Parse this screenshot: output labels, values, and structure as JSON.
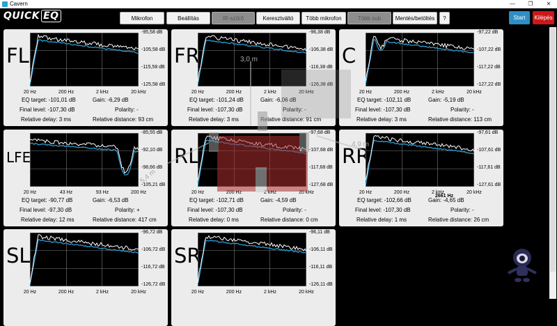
{
  "window": {
    "title": "Cavern",
    "minimize": "—",
    "maximize": "❐",
    "close": "✕"
  },
  "toolbar": {
    "logo_text": "QUICK",
    "logo_eq": "EQ",
    "buttons": [
      {
        "label": "Mikrofon",
        "state": "normal"
      },
      {
        "label": "Beállítás",
        "state": "normal"
      },
      {
        "label": "IR-szűrő",
        "state": "selected"
      },
      {
        "label": "Keresztváltó",
        "state": "normal"
      },
      {
        "label": "Több mikrofon",
        "state": "normal"
      },
      {
        "label": "Több sub",
        "state": "disabled"
      },
      {
        "label": "Mentés/betöltés",
        "state": "normal"
      },
      {
        "label": "?",
        "state": "normal"
      }
    ],
    "start_label": "Start",
    "exit_label": "Kilépés",
    "start_color": "#2d8fc5",
    "exit_color": "#cd1818"
  },
  "colors": {
    "measured": "#ffffff",
    "corrected": "#2aa0d8",
    "grid": "#7f7f7f"
  },
  "overlay": {
    "height_label": "3,0 m",
    "side_label": "4,9 m",
    "front_label": "5,4 m",
    "freq_tooltip": "2661 Hz"
  },
  "channels": [
    {
      "name": "FL",
      "y_labels": [
        "-95,58 dB",
        "-105,58 dB",
        "-115,58 dB",
        "-125,58 dB"
      ],
      "x_labels": [
        "20 Hz",
        "200 Hz",
        "2 kHz",
        "20 kHz"
      ],
      "eq_target": "EQ target: -101,01 dB",
      "gain": "Gain: -6,29 dB",
      "final_level": "Final level: -107,30 dB",
      "polarity": "Polarity: -",
      "relative_delay": "Relative delay: 3 ms",
      "relative_distance": "Relative distance: 93 cm"
    },
    {
      "name": "FR",
      "y_labels": [
        "-96,38 dB",
        "-106,38 dB",
        "-116,38 dB",
        "-126,38 dB"
      ],
      "x_labels": [
        "20 Hz",
        "200 Hz",
        "2 kHz",
        "20 kHz"
      ],
      "eq_target": "EQ target: -101,24 dB",
      "gain": "Gain: -6,06 dB",
      "final_level": "Final level: -107,30 dB",
      "polarity": "Polarity: -",
      "relative_delay": "Relative delay: 3 ms",
      "relative_distance": "Relative distance: 91 cm"
    },
    {
      "name": "C",
      "y_labels": [
        "-97,22 dB",
        "-107,22 dB",
        "-117,22 dB",
        "-127,22 dB"
      ],
      "x_labels": [
        "20 Hz",
        "200 Hz",
        "2 kHz",
        "20 kHz"
      ],
      "eq_target": "EQ target: -102,11 dB",
      "gain": "Gain: -5,19 dB",
      "final_level": "Final level: -107,30 dB",
      "polarity": "Polarity: -",
      "relative_delay": "Relative delay: 3 ms",
      "relative_distance": "Relative distance: 113 cm"
    },
    {
      "name": "LFE",
      "y_labels": [
        "-85,55 dB",
        "-92,10 dB",
        "-98,66 dB",
        "-105,21 dB"
      ],
      "x_labels": [
        "20 Hz",
        "43 Hz",
        "93 Hz",
        "200 Hz"
      ],
      "eq_target": "EQ target: -90,77 dB",
      "gain": "Gain: -6,53 dB",
      "final_level": "Final level: -97,30 dB",
      "polarity": "Polarity: +",
      "relative_delay": "Relative delay: 12 ms",
      "relative_distance": "Relative distance: 417 cm"
    },
    {
      "name": "RL",
      "y_labels": [
        "-97,68 dB",
        "-107,68 dB",
        "-117,68 dB",
        "-127,68 dB"
      ],
      "x_labels": [
        "20 Hz",
        "200 Hz",
        "2 kHz",
        "20 kHz"
      ],
      "eq_target": "EQ target: -102,71 dB",
      "gain": "Gain: -4,59 dB",
      "final_level": "Final level: -107,30 dB",
      "polarity": "Polarity: -",
      "relative_delay": "Relative delay: 0 ms",
      "relative_distance": "Relative distance: 0 cm"
    },
    {
      "name": "RR",
      "y_labels": [
        "-97,61 dB",
        "-107,61 dB",
        "-117,61 dB",
        "-127,61 dB"
      ],
      "x_labels": [
        "20 Hz",
        "200 Hz",
        "2 kHz",
        "20 kHz"
      ],
      "eq_target": "EQ target: -102,66 dB",
      "gain": "Gain: -4,65 dB",
      "final_level": "Final level: -107,30 dB",
      "polarity": "Polarity: -",
      "relative_delay": "Relative delay: 1 ms",
      "relative_distance": "Relative distance: 26 cm"
    },
    {
      "name": "SL",
      "y_labels": [
        "-96,72 dB",
        "-106,72 dB",
        "-116,72 dB",
        "-126,72 dB"
      ],
      "x_labels": [
        "20 Hz",
        "200 Hz",
        "2 kHz",
        "20 kHz"
      ],
      "eq_target": "",
      "gain": "",
      "final_level": "",
      "polarity": "",
      "relative_delay": "",
      "relative_distance": ""
    },
    {
      "name": "SR",
      "y_labels": [
        "-96,11 dB",
        "-106,11 dB",
        "-116,11 dB",
        "-126,11 dB"
      ],
      "x_labels": [
        "20 Hz",
        "200 Hz",
        "2 kHz",
        "20 kHz"
      ],
      "eq_target": "",
      "gain": "",
      "final_level": "",
      "polarity": "",
      "relative_delay": "",
      "relative_distance": ""
    }
  ]
}
